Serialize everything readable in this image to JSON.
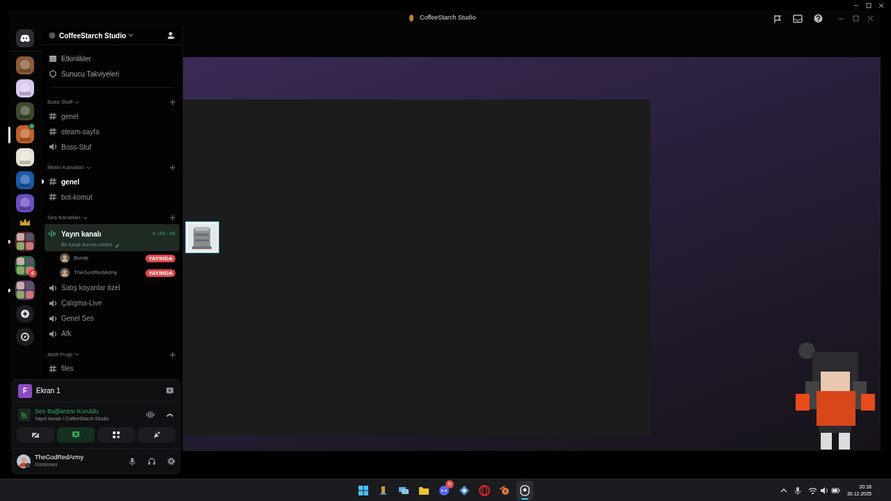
{
  "window": {
    "title": "CoffeeStarch Studio"
  },
  "servers": [
    {
      "kind": "home",
      "selected": false,
      "unread": false,
      "color": "#2b2d31"
    },
    {
      "kind": "server",
      "selected": false,
      "unread": false,
      "color": "#8a5a3a"
    },
    {
      "kind": "server",
      "selected": false,
      "unread": false,
      "color": "#d8c8ee"
    },
    {
      "kind": "server",
      "selected": false,
      "unread": false,
      "color": "#3e4a2c"
    },
    {
      "kind": "server",
      "selected": true,
      "unread": false,
      "color": "#c0602a",
      "badge_dot": true
    },
    {
      "kind": "server",
      "selected": false,
      "unread": false,
      "color": "#e8e2d8"
    },
    {
      "kind": "server",
      "selected": false,
      "unread": false,
      "color": "#1c5aa8"
    },
    {
      "kind": "server",
      "selected": false,
      "unread": false,
      "color": "#6a4ec0"
    },
    {
      "kind": "crown",
      "selected": false,
      "unread": false,
      "color": "#c9a227"
    },
    {
      "kind": "folder",
      "selected": false,
      "unread": true,
      "color": "#5a2a2a"
    },
    {
      "kind": "folder",
      "selected": false,
      "unread": false,
      "color": "#1f6a3a",
      "badge": "6"
    },
    {
      "kind": "folder",
      "selected": false,
      "unread": true,
      "color": "#5a3a6a"
    },
    {
      "kind": "add",
      "selected": false,
      "unread": false,
      "color": "#1e1f22"
    },
    {
      "kind": "discover",
      "selected": false,
      "unread": false,
      "color": "#1e1f22"
    }
  ],
  "sidebar": {
    "server_name": "CoffeeStarch Studio",
    "top_items": [
      {
        "kind": "events",
        "label": "Etkinlikler"
      },
      {
        "kind": "boost",
        "label": "Sunucu Takviyeleri"
      }
    ],
    "categories": [
      {
        "name": "Boss Stuff",
        "channels": [
          {
            "kind": "text",
            "name": "genel",
            "selected": false,
            "unread": false
          },
          {
            "kind": "text",
            "name": "steam-sayfa",
            "selected": false,
            "unread": false
          },
          {
            "kind": "voice",
            "name": "Boss-Stuf",
            "selected": false,
            "unread": false
          }
        ]
      },
      {
        "name": "Metin Kanalları",
        "channels": [
          {
            "kind": "text",
            "name": "genel",
            "selected": false,
            "unread": true
          },
          {
            "kind": "text",
            "name": "bot-komut",
            "selected": false,
            "unread": false
          }
        ]
      },
      {
        "name": "Ses Kanalları",
        "channels": [
          {
            "kind": "voice",
            "name": "Yayın kanalı",
            "selected": true,
            "unread": false,
            "timer": "4:06:46",
            "status": "Bir kanal durumu belirle",
            "members": [
              {
                "name": "Burak",
                "badge": "YAYINDA"
              },
              {
                "name": "TheGodRedArmy",
                "badge": "YAYINDA"
              }
            ]
          },
          {
            "kind": "voice",
            "name": "Satış koyanlar özel",
            "selected": false,
            "unread": false
          },
          {
            "kind": "voice",
            "name": "Çalışma-Live",
            "selected": false,
            "unread": false
          },
          {
            "kind": "voice",
            "name": "Genel Ses",
            "selected": false,
            "unread": false
          },
          {
            "kind": "voice",
            "name": "Afk",
            "selected": false,
            "unread": false
          }
        ]
      },
      {
        "name": "Aktif Proje",
        "channels": [
          {
            "kind": "text",
            "name": "files",
            "selected": false,
            "unread": false
          }
        ]
      }
    ]
  },
  "voice_panel": {
    "stream": {
      "avatar": "F",
      "label": "Ekran 1"
    },
    "connection": {
      "status": "Ses Bağlantısı Kuruldu",
      "location": "Yayın kanalı / CoffeeStarch Studio"
    },
    "buttons": [
      {
        "kind": "camera",
        "active": false
      },
      {
        "kind": "screen",
        "active": true
      },
      {
        "kind": "activities",
        "active": false
      },
      {
        "kind": "soundboard",
        "active": false
      }
    ],
    "user": {
      "name": "TheGodRedArmy",
      "status": "Görünmez"
    }
  },
  "taskbar": {
    "apps": [
      {
        "kind": "start",
        "active": false
      },
      {
        "kind": "app",
        "active": false
      },
      {
        "kind": "windows",
        "active": false
      },
      {
        "kind": "folder",
        "active": false
      },
      {
        "kind": "chat",
        "active": false,
        "badge": "5"
      },
      {
        "kind": "network",
        "active": false
      },
      {
        "kind": "browser",
        "active": false
      },
      {
        "kind": "blender",
        "active": false
      },
      {
        "kind": "recorder",
        "active": true
      }
    ],
    "time": "20:18",
    "date": "30.12.2025"
  }
}
